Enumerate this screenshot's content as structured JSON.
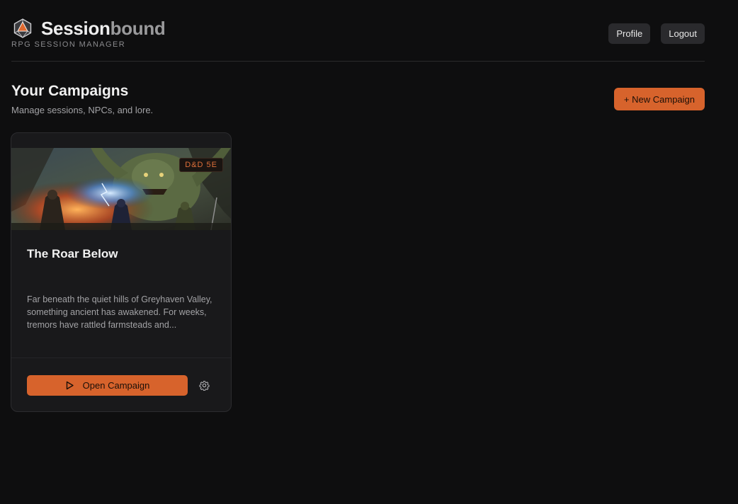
{
  "header": {
    "brand_name_part1": "Session",
    "brand_name_part2": "bound",
    "brand_tagline": "RPG SESSION MANAGER",
    "profile_label": "Profile",
    "logout_label": "Logout"
  },
  "main": {
    "title": "Your Campaigns",
    "subtitle": "Manage sessions, NPCs, and lore.",
    "new_campaign_label": "+ New Campaign"
  },
  "campaigns": [
    {
      "title": "The Roar Below",
      "system_badge": "D&D 5E",
      "description": "Far beneath the quiet hills of Greyhaven Valley, something ancient has awakened. For weeks, tremors have rattled farmsteads and...",
      "open_label": "Open Campaign"
    }
  ],
  "colors": {
    "accent": "#d7632c",
    "background": "#0e0e0f",
    "card": "#19191b"
  },
  "icons": {
    "logo": "d20-die-icon",
    "open": "play-icon",
    "settings": "gear-icon"
  }
}
